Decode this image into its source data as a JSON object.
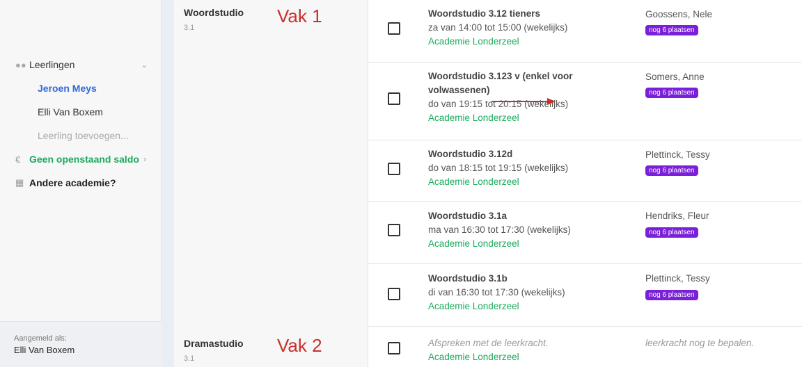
{
  "sidebar": {
    "header_label": "Leerlingen",
    "students": [
      {
        "label": "Jeroen Meys"
      },
      {
        "label": "Elli Van Boxem"
      }
    ],
    "add_student": "Leerling toevoegen...",
    "balance_label": "Geen openstaand saldo",
    "balance_currency": "€",
    "other_academy": "Andere academie?",
    "footer_caption": "Aangemeld als:",
    "footer_user": "Elli Van Boxem",
    "icons": {
      "students": "people-icon",
      "balance": "euro-icon",
      "academy": "building-icon",
      "chevron": "chevron-down-icon",
      "chevron_right": "chevron-right-icon"
    }
  },
  "groups": [
    {
      "title": "Woordstudio",
      "subtitle": "3.1",
      "annotation": "Vak 1",
      "courses": [
        {
          "title": "Woordstudio 3.12 tieners",
          "schedule": "za van 14:00 tot 15:00 (wekelijks)",
          "academy": "Academie Londerzeel",
          "teacher": "Goossens, Nele",
          "badge": "nog 6 plaatsen"
        },
        {
          "title": "Woordstudio 3.123 v (enkel voor",
          "title2": "volwassenen)",
          "schedule": "do van 19:15 tot 20:15 (wekelijks)",
          "academy": "Academie Londerzeel",
          "teacher": "Somers, Anne",
          "badge": "nog 6 plaatsen"
        },
        {
          "title": "Woordstudio 3.12d",
          "schedule": "do van 18:15 tot 19:15 (wekelijks)",
          "academy": "Academie Londerzeel",
          "teacher": "Plettinck, Tessy",
          "badge": "nog 6 plaatsen"
        },
        {
          "title": "Woordstudio 3.1a",
          "schedule": "ma van 16:30 tot 17:30 (wekelijks)",
          "academy": "Academie Londerzeel",
          "teacher": "Hendriks, Fleur",
          "badge": "nog 6 plaatsen"
        },
        {
          "title": "Woordstudio 3.1b",
          "schedule": "di van 16:30 tot 17:30 (wekelijks)",
          "academy": "Academie Londerzeel",
          "teacher": "Plettinck, Tessy",
          "badge": "nog 6 plaatsen"
        }
      ]
    },
    {
      "title": "Dramastudio",
      "subtitle": "3.1",
      "annotation": "Vak 2",
      "courses": [
        {
          "schedule_note": "Afspreken met de leerkracht.",
          "academy": "Academie Londerzeel",
          "teacher_note": "leerkracht nog te bepalen."
        }
      ]
    }
  ],
  "colors": {
    "accent_blue": "#2e6bd6",
    "green": "#1aab5c",
    "badge_purple": "#7a20d9",
    "annotation_red": "#c9302c"
  }
}
